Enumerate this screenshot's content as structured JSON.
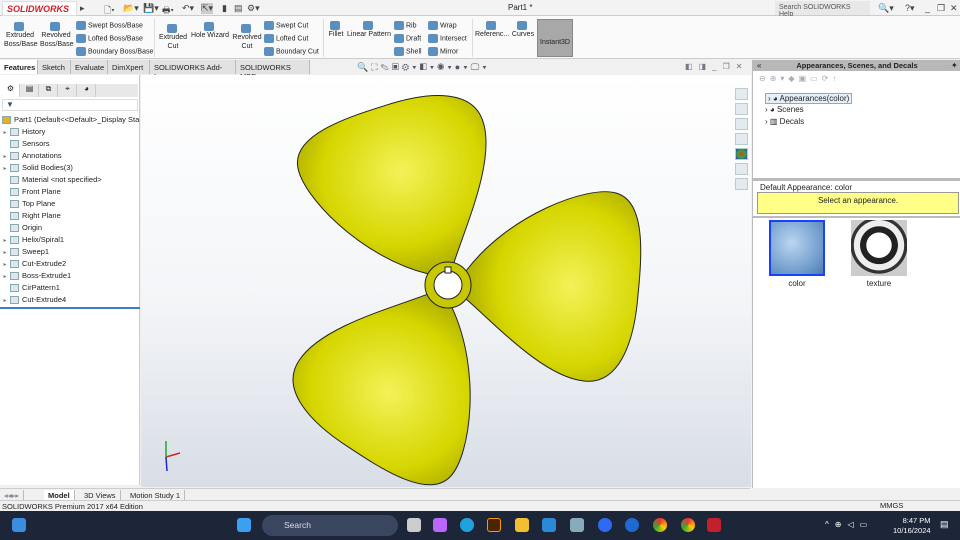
{
  "app": {
    "logo": "SOLIDWORKS",
    "doc_title": "Part1 *",
    "help_search": "Search SOLIDWORKS Help",
    "status": "SOLIDWORKS Premium 2017 x64 Edition",
    "units": "MMGS"
  },
  "ribbon": {
    "extruded_boss": [
      "Extruded",
      "Boss/Base"
    ],
    "revolved_boss": [
      "Revolved",
      "Boss/Base"
    ],
    "swept_boss": "Swept Boss/Base",
    "lofted_boss": "Lofted Boss/Base",
    "boundary_boss": "Boundary Boss/Base",
    "extruded_cut": [
      "Extruded",
      "Cut"
    ],
    "hole_wizard": "Hole Wizard",
    "revolved_cut": [
      "Revolved",
      "Cut"
    ],
    "swept_cut": "Swept Cut",
    "lofted_cut": "Lofted Cut",
    "boundary_cut": "Boundary Cut",
    "fillet": "Fillet",
    "linear_pattern": "Linear Pattern",
    "rib": "Rib",
    "draft": "Draft",
    "shell": "Shell",
    "wrap": "Wrap",
    "intersect": "Intersect",
    "mirror": "Mirror",
    "reference": "Referenc...",
    "curves": "Curves",
    "instant3d": "Instant3D"
  },
  "tabs": [
    "Features",
    "Sketch",
    "Evaluate",
    "DimXpert",
    "SOLIDWORKS Add-Ins",
    "SOLIDWORKS MBD"
  ],
  "tree": {
    "root": "Part1  (Default<<Default>_Display Sta",
    "items": [
      {
        "label": "History",
        "exp": true
      },
      {
        "label": "Sensors",
        "exp": false
      },
      {
        "label": "Annotations",
        "exp": true
      },
      {
        "label": "Solid Bodies(3)",
        "exp": true
      },
      {
        "label": "Material <not specified>",
        "exp": false
      },
      {
        "label": "Front Plane",
        "exp": false
      },
      {
        "label": "Top Plane",
        "exp": false
      },
      {
        "label": "Right Plane",
        "exp": false
      },
      {
        "label": "Origin",
        "exp": false
      },
      {
        "label": "Helix/Spiral1",
        "exp": true
      },
      {
        "label": "Sweep1",
        "exp": true
      },
      {
        "label": "Cut-Extrude2",
        "exp": true
      },
      {
        "label": "Boss-Extrude1",
        "exp": true
      },
      {
        "label": "CirPattern1",
        "exp": false
      },
      {
        "label": "Cut-Extrude4",
        "exp": true
      }
    ]
  },
  "taskpane": {
    "title": "Appearances, Scenes, and Decals",
    "items": [
      "Appearances(color)",
      "Scenes",
      "Decals"
    ],
    "default_label": "Default Appearance: color",
    "prompt": "Select an appearance.",
    "thumbs": [
      "color",
      "texture"
    ]
  },
  "bottom_tabs": [
    "Model",
    "3D Views",
    "Motion Study 1"
  ],
  "taskbar": {
    "search": "Search",
    "time": "8:47 PM",
    "date": "10/16/2024"
  },
  "colors": {
    "part": "#d4d400",
    "accent": "#1a3fff"
  }
}
